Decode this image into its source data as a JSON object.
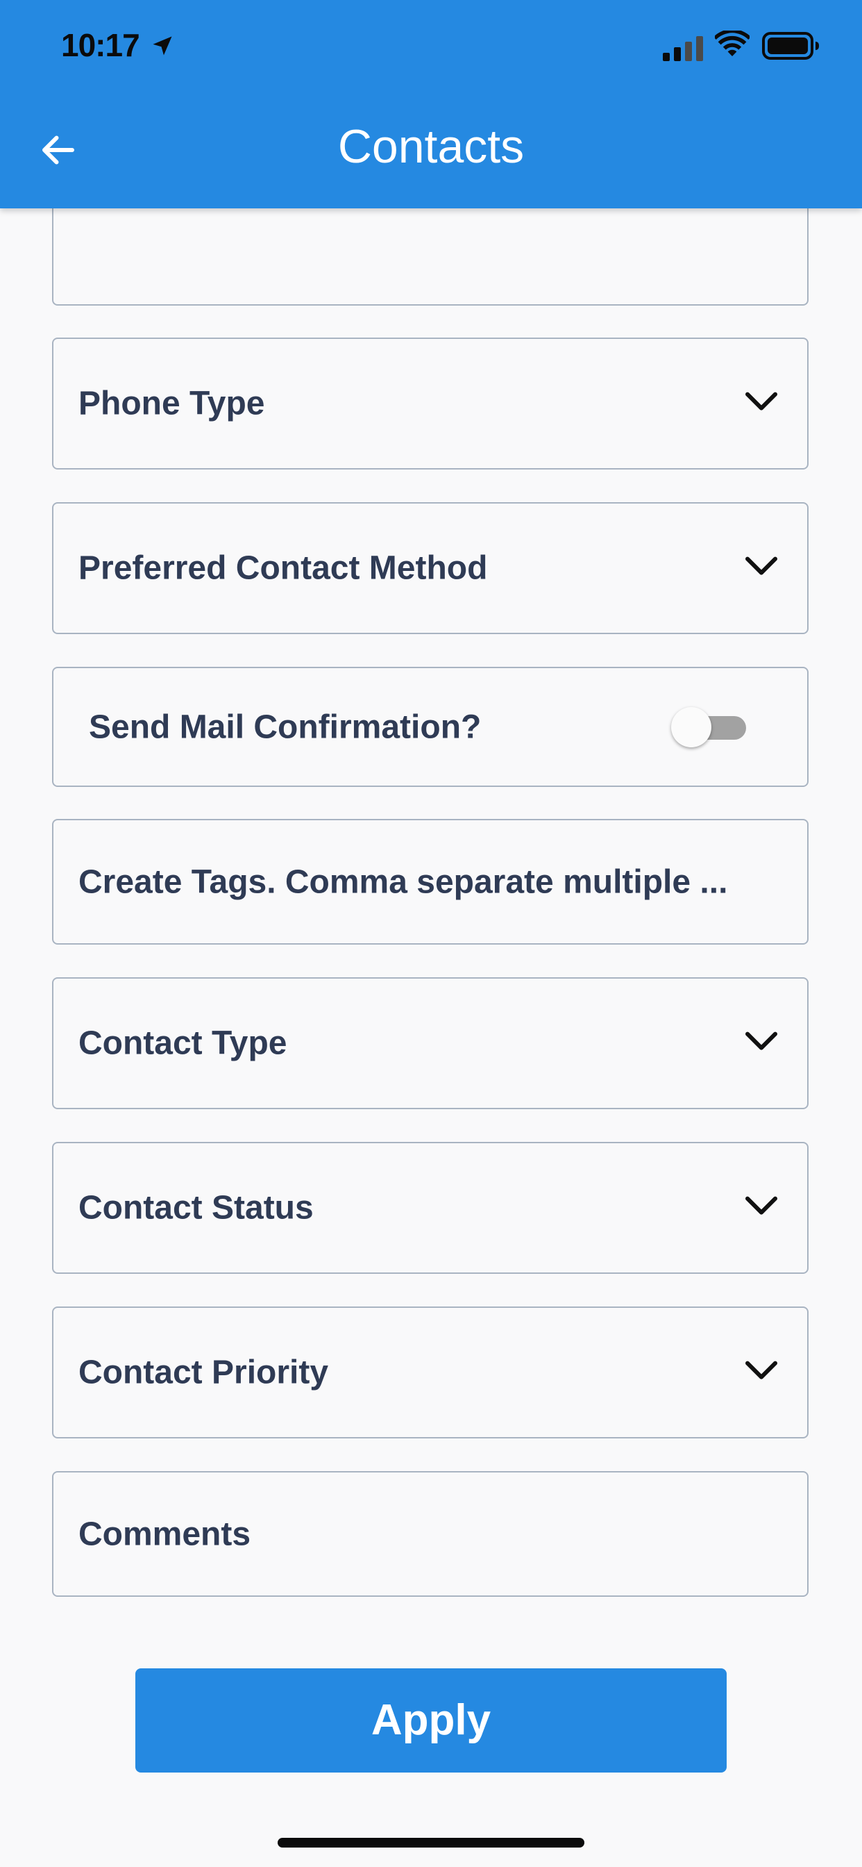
{
  "status_bar": {
    "time": "10:17"
  },
  "header": {
    "title": "Contacts"
  },
  "form": {
    "phone_type": "Phone Type",
    "preferred_contact_method": "Preferred Contact Method",
    "send_mail_confirmation": "Send Mail Confirmation?",
    "send_mail_confirmation_on": false,
    "tags_placeholder": "Create Tags. Comma separate multiple ...",
    "contact_type": "Contact Type",
    "contact_status": "Contact Status",
    "contact_priority": "Contact Priority",
    "comments_placeholder": "Comments"
  },
  "actions": {
    "apply_label": "Apply"
  },
  "icons": {
    "back": "arrow-left-icon",
    "dropdown": "chevron-down-icon",
    "location": "location-arrow-icon",
    "signal": "cellular-signal-icon",
    "wifi": "wifi-icon",
    "battery": "battery-icon"
  },
  "colors": {
    "primary": "#2589e1",
    "field_border": "#a9b4c2",
    "label_text": "#2f3b55",
    "background": "#f9f9fa",
    "toggle_track": "#a2a2a2"
  }
}
